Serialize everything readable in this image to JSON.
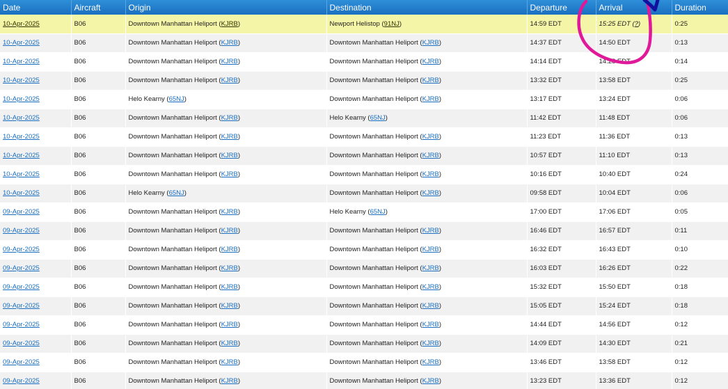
{
  "columns": {
    "date": "Date",
    "aircraft": "Aircraft",
    "origin": "Origin",
    "destination": "Destination",
    "departure": "Departure",
    "arrival": "Arrival",
    "duration": "Duration"
  },
  "rows": [
    {
      "date": "10-Apr-2025",
      "aircraft": "B06",
      "origin_name": "Downtown Manhattan Heliport",
      "origin_code": "KJRB",
      "dest_name": "Newport Helistop",
      "dest_code": "91NJ",
      "departure": "14:59 EDT",
      "arrival": "15:25 EDT",
      "arrival_note": "?",
      "duration": "0:25",
      "highlight": true
    },
    {
      "date": "10-Apr-2025",
      "aircraft": "B06",
      "origin_name": "Downtown Manhattan Heliport",
      "origin_code": "KJRB",
      "dest_name": "Downtown Manhattan Heliport",
      "dest_code": "KJRB",
      "departure": "14:37 EDT",
      "arrival": "14:50 EDT",
      "duration": "0:13"
    },
    {
      "date": "10-Apr-2025",
      "aircraft": "B06",
      "origin_name": "Downtown Manhattan Heliport",
      "origin_code": "KJRB",
      "dest_name": "Downtown Manhattan Heliport",
      "dest_code": "KJRB",
      "departure": "14:14 EDT",
      "arrival": "14:28 EDT",
      "duration": "0:14"
    },
    {
      "date": "10-Apr-2025",
      "aircraft": "B06",
      "origin_name": "Downtown Manhattan Heliport",
      "origin_code": "KJRB",
      "dest_name": "Downtown Manhattan Heliport",
      "dest_code": "KJRB",
      "departure": "13:32 EDT",
      "arrival": "13:58 EDT",
      "duration": "0:25"
    },
    {
      "date": "10-Apr-2025",
      "aircraft": "B06",
      "origin_name": "Helo Kearny",
      "origin_code": "65NJ",
      "dest_name": "Downtown Manhattan Heliport",
      "dest_code": "KJRB",
      "departure": "13:17 EDT",
      "arrival": "13:24 EDT",
      "duration": "0:06"
    },
    {
      "date": "10-Apr-2025",
      "aircraft": "B06",
      "origin_name": "Downtown Manhattan Heliport",
      "origin_code": "KJRB",
      "dest_name": "Helo Kearny",
      "dest_code": "65NJ",
      "departure": "11:42 EDT",
      "arrival": "11:48 EDT",
      "duration": "0:06"
    },
    {
      "date": "10-Apr-2025",
      "aircraft": "B06",
      "origin_name": "Downtown Manhattan Heliport",
      "origin_code": "KJRB",
      "dest_name": "Downtown Manhattan Heliport",
      "dest_code": "KJRB",
      "departure": "11:23 EDT",
      "arrival": "11:36 EDT",
      "duration": "0:13"
    },
    {
      "date": "10-Apr-2025",
      "aircraft": "B06",
      "origin_name": "Downtown Manhattan Heliport",
      "origin_code": "KJRB",
      "dest_name": "Downtown Manhattan Heliport",
      "dest_code": "KJRB",
      "departure": "10:57 EDT",
      "arrival": "11:10 EDT",
      "duration": "0:13"
    },
    {
      "date": "10-Apr-2025",
      "aircraft": "B06",
      "origin_name": "Downtown Manhattan Heliport",
      "origin_code": "KJRB",
      "dest_name": "Downtown Manhattan Heliport",
      "dest_code": "KJRB",
      "departure": "10:16 EDT",
      "arrival": "10:40 EDT",
      "duration": "0:24"
    },
    {
      "date": "10-Apr-2025",
      "aircraft": "B06",
      "origin_name": "Helo Kearny",
      "origin_code": "65NJ",
      "dest_name": "Downtown Manhattan Heliport",
      "dest_code": "KJRB",
      "departure": "09:58 EDT",
      "arrival": "10:04 EDT",
      "duration": "0:06"
    },
    {
      "date": "09-Apr-2025",
      "aircraft": "B06",
      "origin_name": "Downtown Manhattan Heliport",
      "origin_code": "KJRB",
      "dest_name": "Helo Kearny",
      "dest_code": "65NJ",
      "departure": "17:00 EDT",
      "arrival": "17:06 EDT",
      "duration": "0:05"
    },
    {
      "date": "09-Apr-2025",
      "aircraft": "B06",
      "origin_name": "Downtown Manhattan Heliport",
      "origin_code": "KJRB",
      "dest_name": "Downtown Manhattan Heliport",
      "dest_code": "KJRB",
      "departure": "16:46 EDT",
      "arrival": "16:57 EDT",
      "duration": "0:11"
    },
    {
      "date": "09-Apr-2025",
      "aircraft": "B06",
      "origin_name": "Downtown Manhattan Heliport",
      "origin_code": "KJRB",
      "dest_name": "Downtown Manhattan Heliport",
      "dest_code": "KJRB",
      "departure": "16:32 EDT",
      "arrival": "16:43 EDT",
      "duration": "0:10"
    },
    {
      "date": "09-Apr-2025",
      "aircraft": "B06",
      "origin_name": "Downtown Manhattan Heliport",
      "origin_code": "KJRB",
      "dest_name": "Downtown Manhattan Heliport",
      "dest_code": "KJRB",
      "departure": "16:03 EDT",
      "arrival": "16:26 EDT",
      "duration": "0:22"
    },
    {
      "date": "09-Apr-2025",
      "aircraft": "B06",
      "origin_name": "Downtown Manhattan Heliport",
      "origin_code": "KJRB",
      "dest_name": "Downtown Manhattan Heliport",
      "dest_code": "KJRB",
      "departure": "15:32 EDT",
      "arrival": "15:50 EDT",
      "duration": "0:18"
    },
    {
      "date": "09-Apr-2025",
      "aircraft": "B06",
      "origin_name": "Downtown Manhattan Heliport",
      "origin_code": "KJRB",
      "dest_name": "Downtown Manhattan Heliport",
      "dest_code": "KJRB",
      "departure": "15:05 EDT",
      "arrival": "15:24 EDT",
      "duration": "0:18"
    },
    {
      "date": "09-Apr-2025",
      "aircraft": "B06",
      "origin_name": "Downtown Manhattan Heliport",
      "origin_code": "KJRB",
      "dest_name": "Downtown Manhattan Heliport",
      "dest_code": "KJRB",
      "departure": "14:44 EDT",
      "arrival": "14:56 EDT",
      "duration": "0:12"
    },
    {
      "date": "09-Apr-2025",
      "aircraft": "B06",
      "origin_name": "Downtown Manhattan Heliport",
      "origin_code": "KJRB",
      "dest_name": "Downtown Manhattan Heliport",
      "dest_code": "KJRB",
      "departure": "14:09 EDT",
      "arrival": "14:30 EDT",
      "duration": "0:21"
    },
    {
      "date": "09-Apr-2025",
      "aircraft": "B06",
      "origin_name": "Downtown Manhattan Heliport",
      "origin_code": "KJRB",
      "dest_name": "Downtown Manhattan Heliport",
      "dest_code": "KJRB",
      "departure": "13:46 EDT",
      "arrival": "13:58 EDT",
      "duration": "0:12"
    },
    {
      "date": "09-Apr-2025",
      "aircraft": "B06",
      "origin_name": "Downtown Manhattan Heliport",
      "origin_code": "KJRB",
      "dest_name": "Downtown Manhattan Heliport",
      "dest_code": "KJRB",
      "departure": "13:23 EDT",
      "arrival": "13:36 EDT",
      "duration": "0:12"
    }
  ],
  "colors": {
    "header": "#1a6fc0",
    "highlight_row": "#f5f5a8",
    "stripe": "#f1f1f1",
    "link": "#1a6fc0",
    "annotation_circle": "#e0189a",
    "annotation_arrow": "#1010a0"
  },
  "annotation": {
    "shape": "hand-drawn-circle",
    "target": "arrival of first row"
  }
}
